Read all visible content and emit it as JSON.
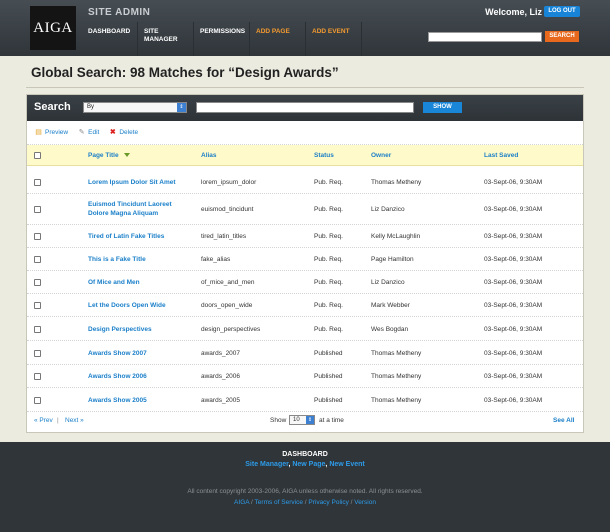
{
  "header": {
    "logo": "AIGA",
    "site_title": "SITE ADMIN",
    "welcome": "Welcome, Liz",
    "logout_label": "LOG OUT",
    "nav": [
      {
        "label": "DASHBOARD",
        "orange": false
      },
      {
        "label": "SITE MANAGER",
        "orange": false
      },
      {
        "label": "PERMISSIONS",
        "orange": false
      },
      {
        "label": "ADD PAGE",
        "orange": true
      },
      {
        "label": "ADD EVENT",
        "orange": true
      }
    ],
    "search_button": "SEARCH"
  },
  "page": {
    "title": "Global Search: 98 Matches for “Design Awards”"
  },
  "search_panel": {
    "label": "Search",
    "select_value": "By",
    "show_button": "SHOW"
  },
  "actions": {
    "preview": "Preview",
    "edit": "Edit",
    "delete": "Delete"
  },
  "table": {
    "columns": {
      "title": "Page Title",
      "alias": "Alias",
      "status": "Status",
      "owner": "Owner",
      "saved": "Last Saved"
    },
    "rows": [
      {
        "title": "Lorem Ipsum Dolor Sit Amet",
        "alias": "lorem_ipsum_dolor",
        "status": "Pub. Req.",
        "owner": "Thomas Metheny",
        "saved": "03-Sept-06, 9:30AM"
      },
      {
        "title": "Euismod Tincidunt Laoreet Dolore Magna Aliquam",
        "alias": "euismod_tincidunt",
        "status": "Pub. Req.",
        "owner": "Liz Danzico",
        "saved": "03-Sept-06, 9:30AM"
      },
      {
        "title": "Tired of Latin Fake Titles",
        "alias": "tired_latin_titles",
        "status": "Pub. Req.",
        "owner": "Kelly McLaughlin",
        "saved": "03-Sept-06, 9:30AM"
      },
      {
        "title": "This is a Fake Title",
        "alias": "fake_alias",
        "status": "Pub. Req.",
        "owner": "Page Hamilton",
        "saved": "03-Sept-06, 9:30AM"
      },
      {
        "title": "Of Mice and Men",
        "alias": "of_mice_and_men",
        "status": "Pub. Req.",
        "owner": "Liz Danzico",
        "saved": "03-Sept-06, 9:30AM"
      },
      {
        "title": "Let the Doors Open Wide",
        "alias": "doors_open_wide",
        "status": "Pub. Req.",
        "owner": "Mark Webber",
        "saved": "03-Sept-06, 9:30AM"
      },
      {
        "title": "Design Perspectives",
        "alias": "design_perspectives",
        "status": "Pub. Req.",
        "owner": "Wes Bogdan",
        "saved": "03-Sept-06, 9:30AM"
      },
      {
        "title": "Awards Show 2007",
        "alias": "awards_2007",
        "status": "Published",
        "owner": "Thomas Metheny",
        "saved": "03-Sept-06, 9:30AM"
      },
      {
        "title": "Awards Show 2006",
        "alias": "awards_2006",
        "status": "Published",
        "owner": "Thomas Metheny",
        "saved": "03-Sept-06, 9:30AM"
      },
      {
        "title": "Awards Show 2005",
        "alias": "awards_2005",
        "status": "Published",
        "owner": "Thomas Metheny",
        "saved": "03-Sept-06, 9:30AM"
      }
    ]
  },
  "pagination": {
    "prev": "« Prev",
    "separator": "|",
    "next": "Next »",
    "show_label": "Show",
    "per_page": "10",
    "at_time": "at a time",
    "see_all": "See All"
  },
  "footer": {
    "dashboard": "DASHBOARD",
    "links": [
      "Site Manager",
      "New Page",
      "New Event"
    ],
    "copyright": "All content copyright 2003-2006, AIGA unless otherwise noted. All rights reserved.",
    "legal": [
      "AIGA",
      "Terms of Service",
      "Privacy Policy",
      "Version"
    ]
  },
  "colors": {
    "accent_blue": "#1a7fc9",
    "header_bg": "#2f3539",
    "search_orange": "#e8691e",
    "nav_orange": "#f39a30",
    "table_header_bg": "#fffac9"
  }
}
